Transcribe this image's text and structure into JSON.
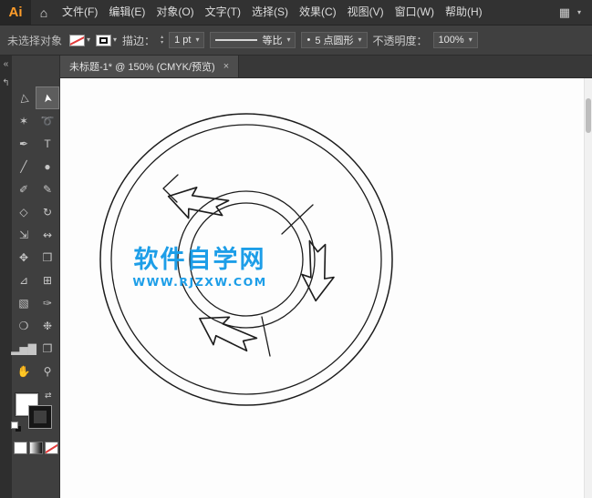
{
  "app": {
    "logo": "Ai"
  },
  "menubar": {
    "items": [
      "文件(F)",
      "编辑(E)",
      "对象(O)",
      "文字(T)",
      "选择(S)",
      "效果(C)",
      "视图(V)",
      "窗口(W)",
      "帮助(H)"
    ]
  },
  "icons": {
    "home": "⌂",
    "workspace": "▦",
    "collapse": "«",
    "dock_arrow": "↰",
    "chevron": "▾",
    "stepper_up": "▴",
    "stepper_down": "▾",
    "swap": "⇄",
    "close": "×",
    "bullet": "•"
  },
  "controlbar": {
    "status": "未选择对象",
    "stroke_label": "描边：",
    "stroke_value": "1 pt",
    "profile_label": "等比",
    "brush_label": "5 点圆形",
    "opacity_label": "不透明度：",
    "opacity_value": "100%"
  },
  "document_tab": {
    "title": "未标题-1* @ 150% (CMYK/预览)"
  },
  "tools": {
    "items": [
      {
        "name": "direct-selection-tool",
        "glyph": "▷"
      },
      {
        "name": "selection-tool",
        "glyph": "➤",
        "selected": true
      },
      {
        "name": "magic-wand-tool",
        "glyph": "✶"
      },
      {
        "name": "lasso-tool",
        "glyph": "➰"
      },
      {
        "name": "pen-tool",
        "glyph": "✒"
      },
      {
        "name": "type-tool",
        "glyph": "T"
      },
      {
        "name": "line-segment-tool",
        "glyph": "╱"
      },
      {
        "name": "ellipse-tool",
        "glyph": "●"
      },
      {
        "name": "paintbrush-tool",
        "glyph": "✐"
      },
      {
        "name": "pencil-tool",
        "glyph": "✎"
      },
      {
        "name": "shaper-tool",
        "glyph": "◇"
      },
      {
        "name": "rotate-tool",
        "glyph": "↻"
      },
      {
        "name": "scale-tool",
        "glyph": "⇲"
      },
      {
        "name": "width-tool",
        "glyph": "↭"
      },
      {
        "name": "free-transform-tool",
        "glyph": "✥"
      },
      {
        "name": "shape-builder-tool",
        "glyph": "❒"
      },
      {
        "name": "perspective-grid-tool",
        "glyph": "⊿"
      },
      {
        "name": "mesh-tool",
        "glyph": "⊞"
      },
      {
        "name": "gradient-tool",
        "glyph": "▧"
      },
      {
        "name": "eyedropper-tool",
        "glyph": "✑"
      },
      {
        "name": "blend-tool",
        "glyph": "❍"
      },
      {
        "name": "symbol-sprayer-tool",
        "glyph": "❉"
      },
      {
        "name": "column-graph-tool",
        "glyph": "▂▅▇"
      },
      {
        "name": "artboard-tool",
        "glyph": "❐"
      },
      {
        "name": "hand-tool",
        "glyph": "✋"
      },
      {
        "name": "zoom-tool",
        "glyph": "⚲"
      }
    ]
  },
  "artwork": {
    "title": "软件自学网",
    "url": "WWW.RJZXW.COM",
    "color": "#1d9ee8"
  }
}
